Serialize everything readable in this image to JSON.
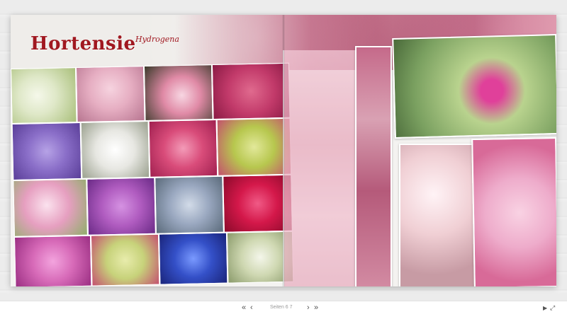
{
  "title": "Hortensie",
  "subtitle_sep": "–",
  "subtitle": "Hydrogena",
  "page_label": "Seiten 6 7",
  "nav": {
    "first_icon": "double-chevron-left-icon",
    "prev_icon": "chevron-left-icon",
    "next_icon": "chevron-right-icon",
    "last_icon": "double-chevron-right-icon",
    "play_icon": "play-icon",
    "fullscreen_icon": "expand-icon"
  },
  "colors": {
    "title": "#a01820",
    "tiles": [
      "#dfe8c8",
      "#e6aec2",
      "#e08aa6",
      "#c23a6a",
      "#8a6ec8",
      "#e7e7e2",
      "#d94c7a",
      "#b7c74e",
      "#e69fc0",
      "#b05cc0",
      "#9aa8c0",
      "#d4184a",
      "#d76ab8",
      "#c7d27a",
      "#3450c8",
      "#cfd8b2"
    ],
    "right_photos": [
      "#d9a1b3",
      "#b9d38e",
      "#f0cfd4",
      "#eeaccb"
    ],
    "magenta": "#e0409a"
  }
}
